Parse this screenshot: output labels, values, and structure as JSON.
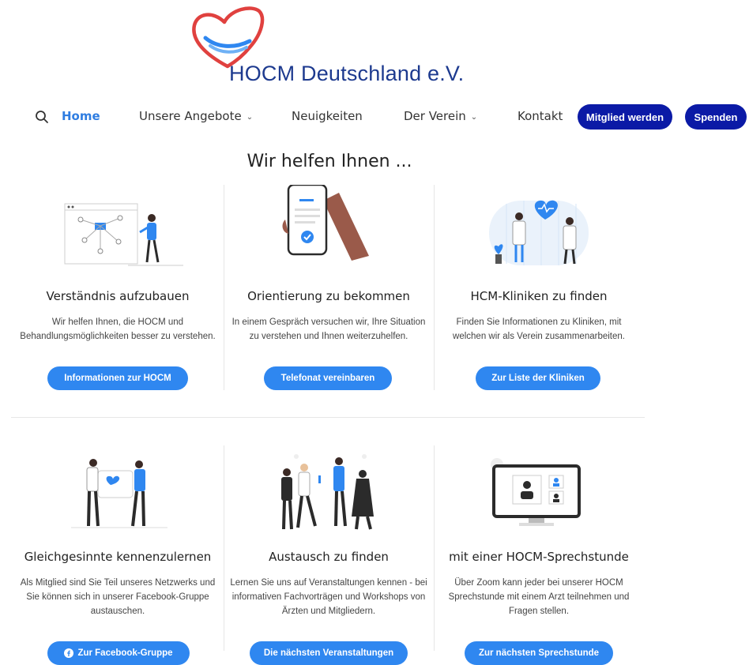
{
  "logo": {
    "text": "HOCM Deutschland e.V.",
    "icon": "heart-icon"
  },
  "nav": {
    "items": [
      {
        "label": "Home",
        "active": true
      },
      {
        "label": "Unsere Angebote",
        "dropdown": true
      },
      {
        "label": "Neuigkeiten"
      },
      {
        "label": "Der Verein",
        "dropdown": true
      },
      {
        "label": "Kontakt"
      }
    ],
    "chevron": "⌄",
    "member_button": "Mitglied werden",
    "donate_button": "Spenden"
  },
  "section_title": "Wir helfen Ihnen ...",
  "cards": [
    {
      "title": "Verständnis aufzubauen",
      "desc": "Wir helfen Ihnen, die HOCM und Behandlungsmöglichkeiten besser zu verstehen.",
      "button": "Informationen zur HOCM"
    },
    {
      "title": "Orientierung zu bekommen",
      "desc": "In einem Gespräch versuchen wir, Ihre Situation zu verstehen und Ihnen weiterzuhelfen.",
      "button": "Telefonat vereinbaren"
    },
    {
      "title": "HCM-Kliniken zu finden",
      "desc": "Finden Sie Informationen zu Kliniken, mit welchen wir als Verein zusammenarbeiten.",
      "button": "Zur Liste der Kliniken"
    },
    {
      "title": "Gleichgesinnte kennenzulernen",
      "desc": "Als Mitglied sind Sie Teil unseres Netzwerks und Sie können sich in unserer Facebook-Gruppe austauschen.",
      "button": "Zur Facebook-Gruppe"
    },
    {
      "title": "Austausch zu finden",
      "desc": "Lernen Sie uns auf Veranstaltungen kennen - bei informativen Fachvorträgen und Workshops von Ärzten und Mitgliedern.",
      "button": "Die nächsten Veranstaltungen"
    },
    {
      "title": "mit einer HOCM-Sprechstunde",
      "desc": "Über Zoom kann jeder bei unserer HOCM Sprechstunde mit einem Arzt teilnehmen und Fragen stellen.",
      "button": "Zur nächsten Sprechstunde"
    }
  ],
  "colors": {
    "accent": "#2f87f0",
    "navy": "#0b1aa6",
    "brand": "#1d3a8f",
    "heart": "#e0413f"
  }
}
